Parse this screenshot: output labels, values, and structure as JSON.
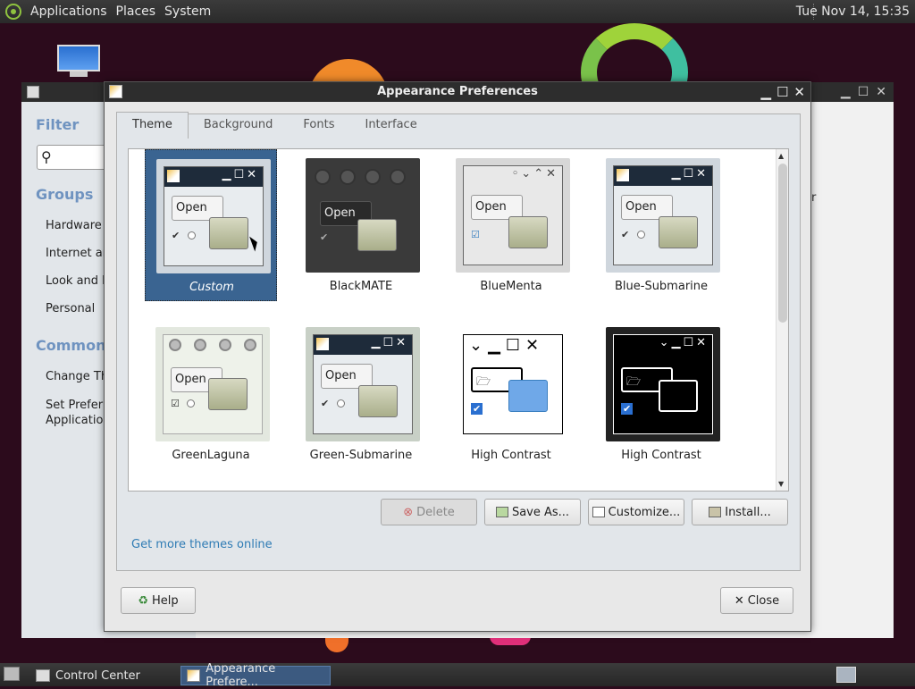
{
  "panel": {
    "menus": [
      "Applications",
      "Places",
      "System"
    ],
    "clock": "Tue Nov 14, 15:35"
  },
  "control_center": {
    "filter_heading": "Filter",
    "groups_heading": "Groups",
    "groups": [
      "Hardware",
      "Internet an",
      "Look and F",
      "Personal"
    ],
    "common_heading": "Common T",
    "common_items": [
      "Change Th",
      "Set Preferr\nApplication"
    ],
    "right_fragment": "er"
  },
  "dialog": {
    "title": "Appearance Preferences",
    "tabs": [
      "Theme",
      "Background",
      "Fonts",
      "Interface"
    ],
    "themes": [
      {
        "name": "Custom",
        "selected": true
      },
      {
        "name": "BlackMATE"
      },
      {
        "name": "BlueMenta"
      },
      {
        "name": "Blue-Submarine"
      },
      {
        "name": "GreenLaguna"
      },
      {
        "name": "Green-Submarine"
      },
      {
        "name": "High Contrast"
      },
      {
        "name": "High Contrast"
      }
    ],
    "preview_open_label": "Open",
    "buttons": {
      "delete": "Delete",
      "save_as": "Save As...",
      "customize": "Customize...",
      "install": "Install..."
    },
    "more_themes_link": "Get more themes online",
    "help": "Help",
    "close": "Close"
  },
  "taskbar": {
    "items": [
      "Control Center",
      "Appearance Prefere..."
    ]
  },
  "colors": {
    "desktop": "#2c0b1c",
    "selection": "#3a6491",
    "link": "#2e7bb4"
  }
}
